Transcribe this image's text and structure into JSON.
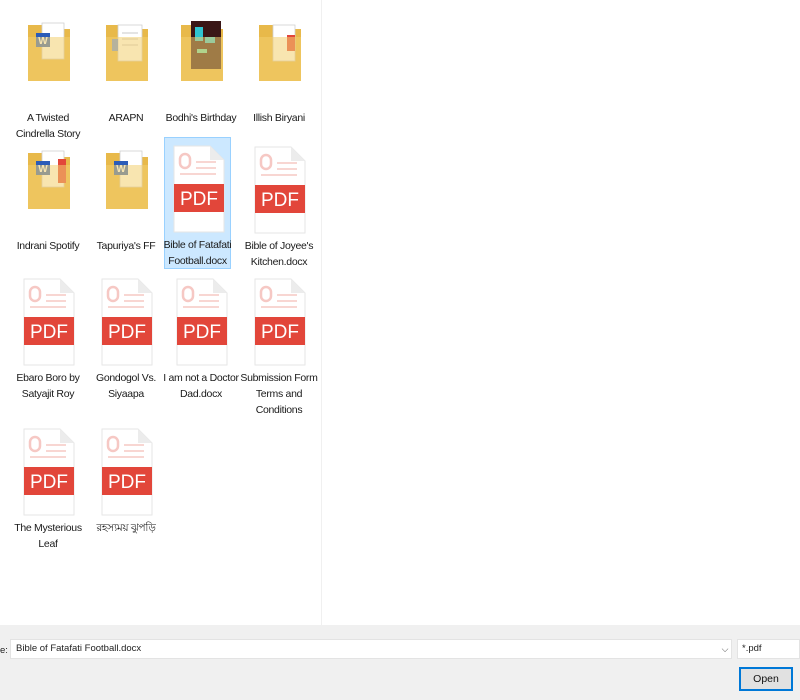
{
  "files": [
    {
      "label": "A Twisted Cindrella Story",
      "type": "folder-word",
      "icon": "folder-with-word-doc-icon",
      "selected": false
    },
    {
      "label": "ARAPN",
      "type": "folder-docs",
      "icon": "folder-with-documents-icon",
      "selected": false
    },
    {
      "label": "Bodhi's Birthday",
      "type": "folder-image",
      "icon": "folder-with-image-icon",
      "selected": false
    },
    {
      "label": "Illish Biryani",
      "type": "folder-pdf",
      "icon": "folder-with-pdf-icon",
      "selected": false
    },
    {
      "label": "Indrani Spotify",
      "type": "folder-word-pdf",
      "icon": "folder-with-word-and-pdf-icon",
      "selected": false
    },
    {
      "label": "Tapuriya's FF",
      "type": "folder-word",
      "icon": "folder-with-word-doc-icon",
      "selected": false
    },
    {
      "label": "Bible of Fatafati Football.docx",
      "type": "pdf",
      "icon": "pdf-file-icon",
      "selected": true
    },
    {
      "label": "Bible of Joyee's Kitchen.docx",
      "type": "pdf",
      "icon": "pdf-file-icon",
      "selected": false
    },
    {
      "label": "Ebaro Boro by Satyajit Roy",
      "type": "pdf",
      "icon": "pdf-file-icon",
      "selected": false
    },
    {
      "label": "Gondogol Vs. Siyaapa",
      "type": "pdf",
      "icon": "pdf-file-icon",
      "selected": false
    },
    {
      "label": "I am not a Doctor Dad.docx",
      "type": "pdf",
      "icon": "pdf-file-icon",
      "selected": false
    },
    {
      "label": "Submission Form Terms and Conditions",
      "type": "pdf",
      "icon": "pdf-file-icon",
      "selected": false
    },
    {
      "label": "The Mysterious Leaf",
      "type": "pdf",
      "icon": "pdf-file-icon",
      "selected": false
    },
    {
      "label": "রহস্যময় ঝুপড়ি",
      "type": "pdf",
      "icon": "pdf-file-icon",
      "selected": false
    }
  ],
  "pdf_badge_text": "PDF",
  "footer": {
    "filename_label": "e:",
    "filename_value": "Bible of Fatafati Football.docx",
    "filter_value": "*.pdf",
    "open_button": "Open"
  },
  "colors": {
    "selection_bg": "#cce8ff",
    "selection_border": "#99d1ff",
    "pdf_red": "#e2463a",
    "folder_yellow": "#f3d070",
    "word_blue": "#2b5cb8",
    "accent_blue": "#0078d7"
  }
}
